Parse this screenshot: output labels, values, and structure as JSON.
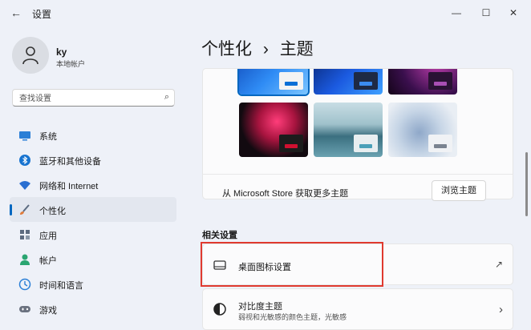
{
  "window": {
    "title": "设置",
    "back_icon": "←",
    "min_icon": "—",
    "max_icon": "☐",
    "close_icon": "✕"
  },
  "user": {
    "name": "ky",
    "account_type": "本地帐户"
  },
  "search": {
    "placeholder": "查找设置",
    "icon": "⌕"
  },
  "nav": {
    "items": [
      {
        "label": "系统",
        "icon": "monitor-icon",
        "color": "#2b7fd6"
      },
      {
        "label": "蓝牙和其他设备",
        "icon": "bluetooth-icon",
        "color": "#1874d0"
      },
      {
        "label": "网络和 Internet",
        "icon": "wifi-icon",
        "color": "#2a6fd1"
      },
      {
        "label": "个性化",
        "icon": "brush-icon",
        "color": "#e07b39",
        "active": true
      },
      {
        "label": "应用",
        "icon": "apps-icon",
        "color": "#5c6b80"
      },
      {
        "label": "帐户",
        "icon": "person-icon",
        "color": "#2aa571"
      },
      {
        "label": "时间和语言",
        "icon": "globe-clock-icon",
        "color": "#2b7fd6"
      },
      {
        "label": "游戏",
        "icon": "gamepad-icon",
        "color": "#6b7280"
      }
    ]
  },
  "breadcrumb": {
    "parent": "个性化",
    "separator": "›",
    "current": "主题"
  },
  "themes": {
    "store_text": "从 Microsoft Store 获取更多主题",
    "browse_button": "浏览主题"
  },
  "related": {
    "heading": "相关设置",
    "items": [
      {
        "title": "桌面图标设置",
        "icon": "desktop-icon",
        "tail_icon": "↗"
      },
      {
        "title": "对比度主题",
        "subtitle": "弱视和光敏感的颜色主题，光敏感",
        "icon": "contrast-icon",
        "tail_icon": "›"
      }
    ]
  },
  "colors": {
    "accent": "#0067c0",
    "highlight": "#e03a2f"
  }
}
